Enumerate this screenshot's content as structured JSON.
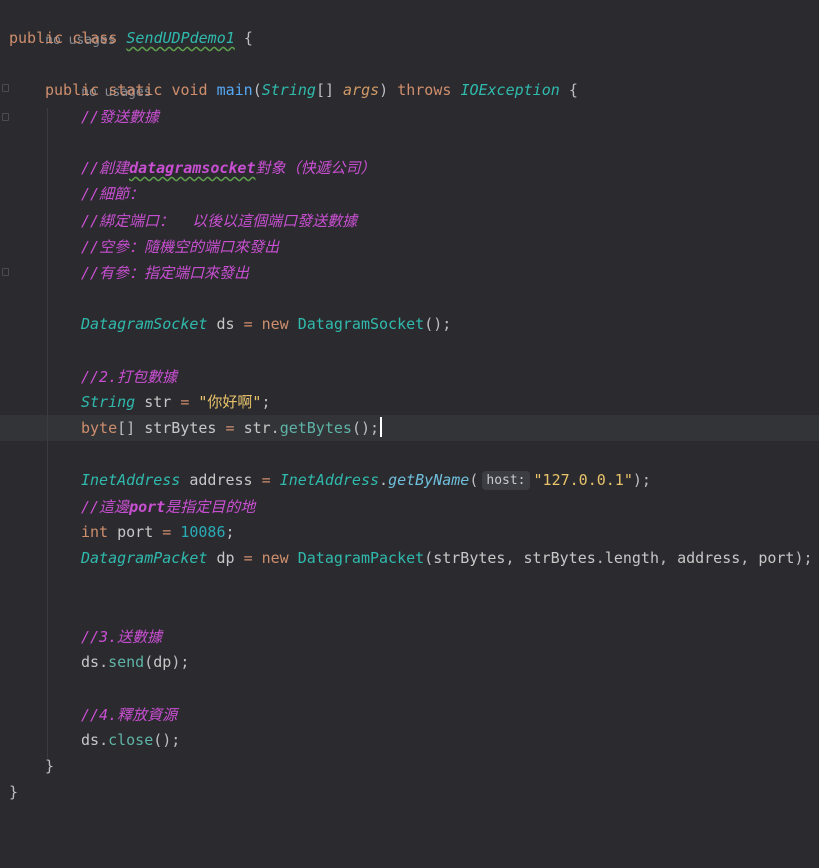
{
  "editor": {
    "usage_hint_class": "no usages",
    "usage_hint_method": "no usages",
    "kw_public": "public",
    "kw_class": "class",
    "class_name": "SendUDPdemo1",
    "kw_static": "static",
    "kw_void": "void",
    "method_name": "main",
    "param_type": "String",
    "param_name": "args",
    "kw_throws": "throws",
    "exception_type": "IOException",
    "comment_send_data": "//發送數據",
    "comment_create_prefix": "//創建",
    "comment_create_word": "datagramsocket",
    "comment_create_suffix": "對象（快遞公司）",
    "comment_details": "//細節：",
    "comment_bind": "//綁定端口：  以後以這個端口發送數據",
    "comment_empty_arg": "//空參：隨機空的端口來發出",
    "comment_with_arg": "//有參：指定端口來發出",
    "type_datagram_socket": "DatagramSocket",
    "var_ds": "ds",
    "kw_new": "new",
    "comment_pack": "//2.打包數據",
    "type_string": "String",
    "var_str": "str",
    "string_value": "\"你好啊\"",
    "kw_byte": "byte",
    "var_strbytes": "strBytes",
    "method_getbytes": "getBytes",
    "type_inetaddress": "InetAddress",
    "var_address": "address",
    "method_getbyname": "getByName",
    "hint_host": "host:",
    "string_ip": "\"127.0.0.1\"",
    "comment_port_prefix": "//這邊",
    "comment_port_word": "port",
    "comment_port_suffix": "是指定目的地",
    "kw_int": "int",
    "var_port": "port",
    "port_value": "10086",
    "type_datagram_packet": "DatagramPacket",
    "var_dp": "dp",
    "field_length": "length",
    "comment_send": "//3.送數據",
    "method_send": "send",
    "comment_release": "//4.釋放資源",
    "method_close": "close"
  },
  "colors": {
    "background": "#2b2b2f",
    "keyword": "#cf8e6d",
    "comment": "#c94fd2",
    "type": "#2fbaad",
    "string": "#e8c36b",
    "number": "#2aacb8"
  }
}
